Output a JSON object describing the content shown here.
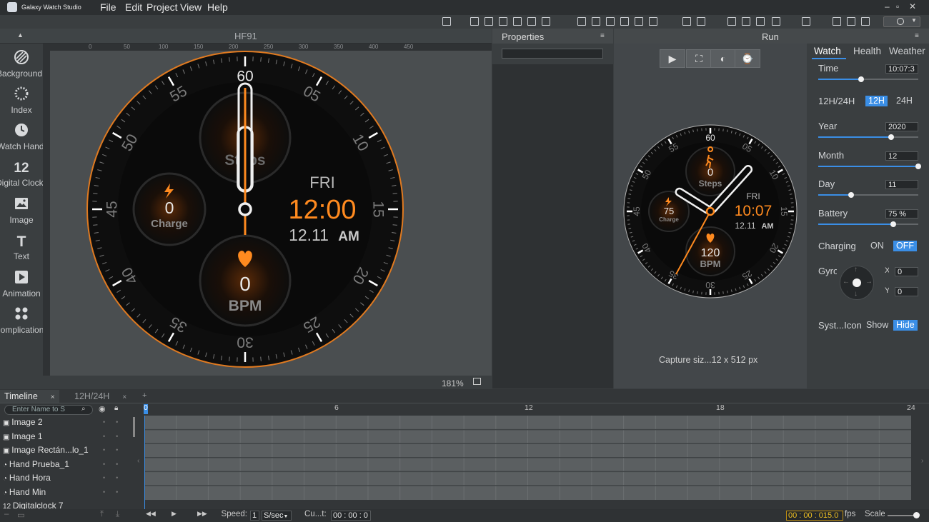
{
  "app": {
    "title": "Galaxy Watch Studio"
  },
  "menu": [
    "File",
    "Edit",
    "Project",
    "View",
    "Help"
  ],
  "canvas": {
    "tab_title": "HF91",
    "zoom": "181%",
    "ruler_ticks": [
      "0",
      "50",
      "100",
      "150",
      "200",
      "250",
      "300",
      "350",
      "400",
      "450"
    ]
  },
  "left_toolbar": [
    {
      "label": "Background",
      "icon": "background-icon"
    },
    {
      "label": "Index",
      "icon": "index-icon"
    },
    {
      "label": "Watch Hand",
      "icon": "watch-hand-icon"
    },
    {
      "label": "Digital Clock",
      "icon": "digital-clock-icon",
      "glyph": "12"
    },
    {
      "label": "Image",
      "icon": "image-icon"
    },
    {
      "label": "Text",
      "icon": "text-icon",
      "glyph": "T"
    },
    {
      "label": "Animation",
      "icon": "animation-icon"
    },
    {
      "label": "Complication",
      "icon": "complication-icon"
    }
  ],
  "watchface": {
    "minute_labels": [
      "60",
      "05",
      "10",
      "15",
      "20",
      "25",
      "30",
      "35",
      "40",
      "45",
      "50",
      "55"
    ],
    "steps_value": "",
    "steps_label": "Steps",
    "charge_value": "0",
    "charge_label": "Charge",
    "bpm_value": "0",
    "bpm_label": "BPM",
    "day": "FRI",
    "time": "12:00",
    "date": "12.11",
    "ampm": "AM"
  },
  "properties": {
    "title": "Properties"
  },
  "run": {
    "title": "Run",
    "capture_text": "Capture siz...12 x 512 px",
    "preview": {
      "steps_value": "0",
      "steps_label": "Steps",
      "charge_value": "75",
      "charge_label": "Charge",
      "bpm_value": "120",
      "bpm_label": "BPM",
      "day": "FRI",
      "time": "10:07",
      "date": "12.11",
      "ampm": "AM"
    },
    "tabs": [
      "Watch",
      "Health",
      "Weather"
    ],
    "time": {
      "label": "Time",
      "value": "10:07:3",
      "level": 0.43
    },
    "hour_mode": {
      "label": "12H/24H",
      "opt1": "12H",
      "opt2": "24H"
    },
    "year": {
      "label": "Year",
      "value": "2020",
      "level": 0.73
    },
    "month": {
      "label": "Month",
      "value": "12",
      "level": 1.0
    },
    "day": {
      "label": "Day",
      "value": "11",
      "level": 0.33
    },
    "battery": {
      "label": "Battery",
      "value": "75 %",
      "level": 0.75
    },
    "charging": {
      "label": "Charging",
      "on": "ON",
      "off": "OFF"
    },
    "gyro": {
      "label": "Gyro",
      "x_label": "X",
      "x_value": "0",
      "y_label": "Y",
      "y_value": "0"
    },
    "sys_icon": {
      "label": "Syst...Icon",
      "show": "Show",
      "hide": "Hide"
    }
  },
  "timeline": {
    "tabs": [
      "Timeline",
      "12H/24H"
    ],
    "search_placeholder": "Enter Name to S",
    "layers": [
      "Image 2",
      "Image 1",
      "Image Rectán...lo_1",
      "Hand Prueba_1",
      "Hand Hora",
      "Hand Min",
      "Digitalclock 7"
    ],
    "ruler": [
      "0",
      "6",
      "12",
      "18",
      "24"
    ],
    "speed_label": "Speed:",
    "speed_value": "1",
    "speed_unit": "S/sec",
    "cursor_label": "Cu...t:",
    "cursor_value": "00 : 00 : 0",
    "duration": "00 : 00 : 015.0",
    "fps": "fps",
    "scale_label": "Scale"
  },
  "colors": {
    "accent": "#ff8a1f",
    "blue": "#3a8ee6"
  }
}
